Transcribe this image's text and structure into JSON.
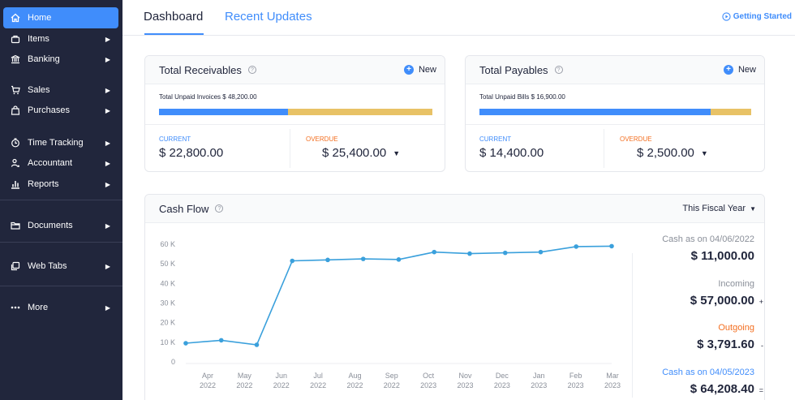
{
  "sidebar": {
    "items": [
      {
        "label": "Home",
        "icon": "home-icon",
        "active": true
      },
      {
        "label": "Items",
        "icon": "items-icon"
      },
      {
        "label": "Banking",
        "icon": "bank-icon"
      },
      {
        "label": "Sales",
        "icon": "cart-icon"
      },
      {
        "label": "Purchases",
        "icon": "bag-icon"
      },
      {
        "label": "Time Tracking",
        "icon": "clock-icon"
      },
      {
        "label": "Accountant",
        "icon": "accountant-icon"
      },
      {
        "label": "Reports",
        "icon": "chart-icon"
      },
      {
        "label": "Documents",
        "icon": "folder-icon"
      },
      {
        "label": "Web Tabs",
        "icon": "webtabs-icon"
      },
      {
        "label": "More",
        "icon": "more-dots-icon"
      }
    ]
  },
  "header": {
    "tabs": [
      {
        "label": "Dashboard",
        "active": true
      },
      {
        "label": "Recent Updates",
        "active": false
      }
    ],
    "getting_started": "Getting Started"
  },
  "receivables": {
    "title": "Total Receivables",
    "new_label": "New",
    "unpaid_text": "Total Unpaid Invoices $ 48,200.00",
    "current_label": "CURRENT",
    "current_amount": "$ 22,800.00",
    "overdue_label": "OVERDUE",
    "overdue_amount": "$ 25,400.00",
    "current_fraction": 0.473
  },
  "payables": {
    "title": "Total Payables",
    "new_label": "New",
    "unpaid_text": "Total Unpaid Bills $ 16,900.00",
    "current_label": "CURRENT",
    "current_amount": "$ 14,400.00",
    "overdue_label": "OVERDUE",
    "overdue_amount": "$ 2,500.00",
    "current_fraction": 0.852
  },
  "cashflow": {
    "title": "Cash Flow",
    "period": "This Fiscal Year",
    "summary": {
      "opening_label": "Cash as on 04/06/2022",
      "opening_value": "$ 11,000.00",
      "incoming_label": "Incoming",
      "incoming_value": "$ 57,000.00",
      "incoming_sign": "+",
      "outgoing_label": "Outgoing",
      "outgoing_value": "$ 3,791.60",
      "outgoing_sign": "-",
      "closing_label": "Cash as on 04/05/2023",
      "closing_value": "$ 64,208.40",
      "closing_sign": "="
    }
  },
  "colors": {
    "accent": "#408dfb",
    "sidebar": "#21263c",
    "overdue": "#e8c266",
    "overdue_text": "#f36f21",
    "line": "#3aa0dc"
  },
  "chart_data": {
    "type": "line",
    "y_ticks": [
      "0",
      "10 K",
      "20 K",
      "30 K",
      "40 K",
      "50 K",
      "60 K"
    ],
    "ylim": [
      0,
      60000
    ],
    "categories": [
      {
        "month": "Apr",
        "year": "2022"
      },
      {
        "month": "May",
        "year": "2022"
      },
      {
        "month": "Jun",
        "year": "2022"
      },
      {
        "month": "Jul",
        "year": "2022"
      },
      {
        "month": "Aug",
        "year": "2022"
      },
      {
        "month": "Sep",
        "year": "2022"
      },
      {
        "month": "Oct",
        "year": "2023"
      },
      {
        "month": "Nov",
        "year": "2023"
      },
      {
        "month": "Dec",
        "year": "2023"
      },
      {
        "month": "Jan",
        "year": "2023"
      },
      {
        "month": "Feb",
        "year": "2023"
      },
      {
        "month": "Mar",
        "year": "2023"
      }
    ],
    "series": [
      {
        "values": [
          9500,
          11000,
          8700,
          51500,
          52000,
          52500,
          52200,
          56000,
          55200,
          55600,
          56000,
          58800,
          59000
        ]
      }
    ],
    "grid": false,
    "legend": "none"
  }
}
